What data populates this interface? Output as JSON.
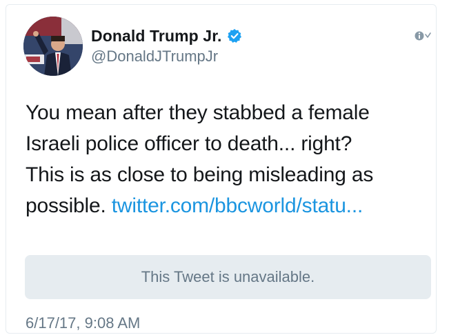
{
  "tweet": {
    "author": {
      "display_name": "Donald Trump Jr.",
      "handle": "@DonaldJTrumpJr",
      "verified_icon": "verified-badge-icon",
      "avatar": "profile-photo"
    },
    "menu_icon": "info-chevron-icon",
    "text_lines": [
      "You mean after they stabbed a female",
      "Israeli police officer to death... right?",
      "This is as close to being misleading as",
      "possible. "
    ],
    "link_text": "twitter.com/bbcworld/statu...",
    "quoted_tweet": {
      "message": "This Tweet is unavailable."
    },
    "timestamp": "6/17/17, 9:08 AM"
  },
  "colors": {
    "link": "#1b95e0",
    "verified": "#1da1f2",
    "secondary_text": "#657786",
    "quote_bg": "#e6ecf0"
  }
}
